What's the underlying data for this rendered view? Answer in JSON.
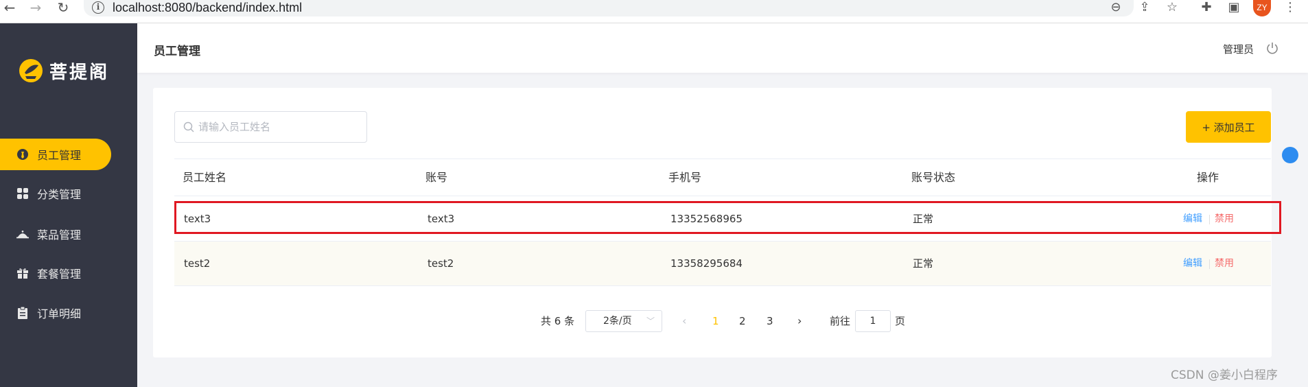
{
  "browser": {
    "url": "localhost:8080/backend/index.html",
    "avatar_initials": "ZY",
    "icons": [
      "back-icon",
      "forward-icon",
      "reload-icon",
      "zoom-icon",
      "share-icon",
      "star-icon",
      "extension-icon",
      "sidepanel-icon",
      "menu-icon"
    ]
  },
  "sidebar": {
    "logo_text": "菩提阁",
    "items": [
      {
        "label": "员工管理",
        "icon": "employee-icon",
        "active": true
      },
      {
        "label": "分类管理",
        "icon": "category-icon",
        "active": false
      },
      {
        "label": "菜品管理",
        "icon": "dish-icon",
        "active": false
      },
      {
        "label": "套餐管理",
        "icon": "combo-gift-icon",
        "active": false
      },
      {
        "label": "订单明细",
        "icon": "order-clipboard-icon",
        "active": false
      }
    ]
  },
  "header": {
    "title": "员工管理",
    "user": "管理员"
  },
  "toolbar": {
    "search_placeholder": "请输入员工姓名",
    "add_label": "+ 添加员工"
  },
  "table": {
    "columns": [
      "员工姓名",
      "账号",
      "手机号",
      "账号状态",
      "操作"
    ],
    "rows": [
      {
        "name": "text3",
        "account": "text3",
        "phone": "13352568965",
        "status": "正常",
        "edit": "编辑",
        "disable": "禁用"
      },
      {
        "name": "test2",
        "account": "test2",
        "phone": "13358295684",
        "status": "正常",
        "edit": "编辑",
        "disable": "禁用"
      }
    ]
  },
  "pagination": {
    "total_label": "共 6 条",
    "page_size": "2条/页",
    "pages": [
      "1",
      "2",
      "3"
    ],
    "current": "1",
    "goto_label": "前往",
    "goto_value": "1",
    "page_suffix": "页"
  },
  "watermark": "CSDN @姜小白程序",
  "colors": {
    "accent": "#ffc200",
    "sidebar": "#343744",
    "edit": "#409eff",
    "disable": "#f56c6c",
    "highlight": "#e01822"
  }
}
